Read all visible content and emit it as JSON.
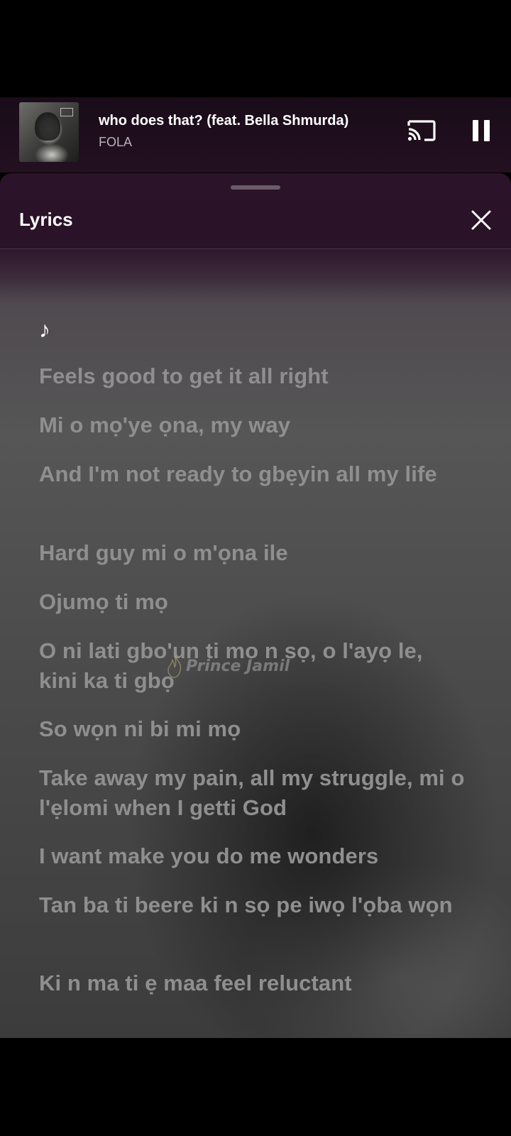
{
  "now_playing": {
    "title": "who does that? (feat. Bella Shmurda)",
    "artist": "FOLA",
    "cast_icon": "cast-icon",
    "pause_icon": "pause-icon"
  },
  "lyrics_panel": {
    "heading": "Lyrics",
    "close_icon": "close-icon",
    "note_glyph": "♪",
    "lines": [
      "Feels good to get it all right",
      "Mi o mọ'ye ọna, my way",
      "And I'm not ready to gbẹyin all my life",
      "Hard guy mi o m'ọna ile",
      "Ojumọ ti mọ",
      "O ni lati gbo'un ti mo n sọ, o l'ayọ le, kini ka ti gbọ",
      "So wọn ni bi mi mọ",
      "Take away my pain, all my struggle, mi o l'ẹlomi when I getti God",
      "I want make you do me wonders",
      "Tan ba ti beere ki n sọ pe iwọ l'ọba wọn",
      "Ki n ma ti ẹ maa feel reluctant"
    ]
  },
  "watermark": {
    "text": "Prince Jamil"
  },
  "colors": {
    "sheet_header": "#2a1228",
    "lyric_inactive": "#8f8f8f",
    "text_primary": "#ffffff"
  }
}
